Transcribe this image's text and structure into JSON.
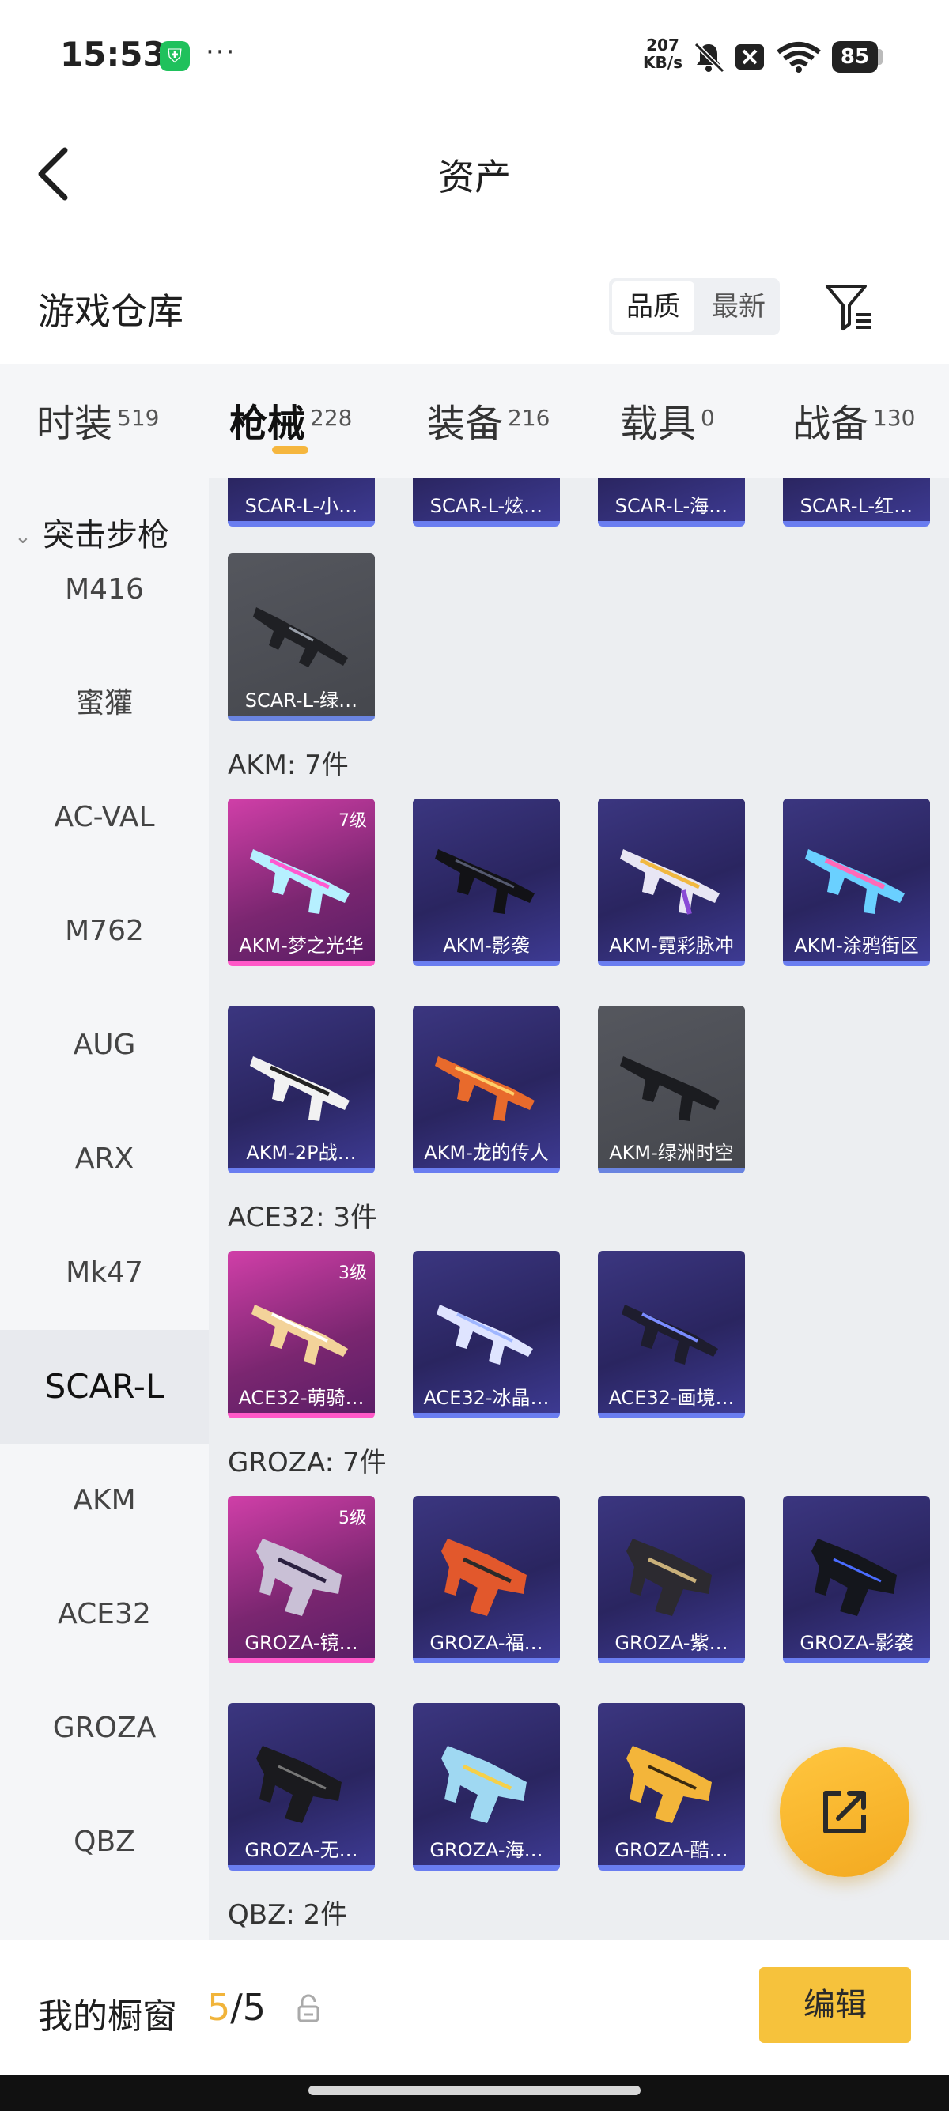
{
  "status_bar": {
    "time": "15:53",
    "more": "···",
    "net_rate_value": "207",
    "net_rate_unit": "KB/s",
    "battery": "85",
    "icons": [
      "app-shield-icon",
      "mute-bell-icon",
      "sim-off-icon",
      "wifi-icon",
      "battery-icon"
    ]
  },
  "nav": {
    "title": "资产"
  },
  "header": {
    "title": "游戏仓库",
    "sort_options": [
      "品质",
      "最新"
    ],
    "sort_selected": "品质"
  },
  "tabs": [
    {
      "label": "时装",
      "count": "519"
    },
    {
      "label": "枪械",
      "count": "228",
      "active": true
    },
    {
      "label": "装备",
      "count": "216"
    },
    {
      "label": "载具",
      "count": "0"
    },
    {
      "label": "战备",
      "count": "130"
    }
  ],
  "sidebar": {
    "group": "突击步枪",
    "items": [
      "M416",
      "蜜獾",
      "AC-VAL",
      "M762",
      "AUG",
      "ARX",
      "Mk47",
      "SCAR-L",
      "AKM",
      "ACE32",
      "GROZA",
      "QBZ"
    ],
    "selected": "SCAR-L"
  },
  "grid": {
    "scar_top_row": [
      "SCAR-L-小…",
      "SCAR-L-炫…",
      "SCAR-L-海…",
      "SCAR-L-红…"
    ],
    "scar_last": "SCAR-L-绿…",
    "akm": {
      "title": "AKM: 7件",
      "items": [
        {
          "name": "AKM-梦之光华",
          "level": "7级"
        },
        {
          "name": "AKM-影袭"
        },
        {
          "name": "AKM-霓彩脉冲"
        },
        {
          "name": "AKM-涂鸦街区"
        },
        {
          "name": "AKM-2P战…"
        },
        {
          "name": "AKM-龙的传人"
        },
        {
          "name": "AKM-绿洲时空"
        }
      ]
    },
    "ace32": {
      "title": "ACE32: 3件",
      "items": [
        {
          "name": "ACE32-萌骑…",
          "level": "3级"
        },
        {
          "name": "ACE32-冰晶…"
        },
        {
          "name": "ACE32-画境…"
        }
      ]
    },
    "groza": {
      "title": "GROZA: 7件",
      "items": [
        {
          "name": "GROZA-镜…",
          "level": "5级"
        },
        {
          "name": "GROZA-福…"
        },
        {
          "name": "GROZA-紫…"
        },
        {
          "name": "GROZA-影袭"
        },
        {
          "name": "GROZA-无…"
        },
        {
          "name": "GROZA-海…"
        },
        {
          "name": "GROZA-酷…"
        }
      ]
    },
    "qbz": {
      "title": "QBZ: 2件"
    }
  },
  "bottom": {
    "label": "我的橱窗",
    "used": "5",
    "separator": "/",
    "total": "5",
    "edit_label": "编辑"
  },
  "colors": {
    "accent": "#f6c23c",
    "tab_underline": "#f5b63e",
    "card_purple": "#2f2a6e",
    "card_pink": "#c23c9e",
    "card_grey": "#4f5157"
  }
}
